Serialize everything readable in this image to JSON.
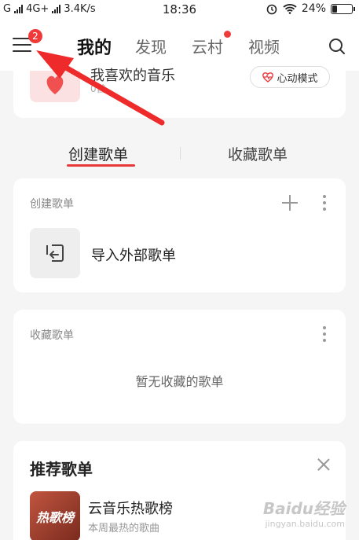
{
  "status_bar": {
    "carrier1": "G",
    "carrier2": "4G+",
    "speed": "3.4K/s",
    "time": "18:36",
    "battery": "24%",
    "battery_level": 0.24
  },
  "nav": {
    "menu_badge": "2",
    "tabs": [
      "我的",
      "发现",
      "云村",
      "视频"
    ],
    "active_tab": "我的"
  },
  "liked": {
    "title": "我喜欢的音乐",
    "count": "0首",
    "heart_mode_label": "心动模式"
  },
  "segments": {
    "created": "创建歌单",
    "collected": "收藏歌单"
  },
  "created_section": {
    "title": "创建歌单",
    "import_label": "导入外部歌单"
  },
  "collected_section": {
    "title": "收藏歌单",
    "empty_text": "暂无收藏的歌单"
  },
  "recommend": {
    "title": "推荐歌单",
    "playlist_name": "云音乐热歌榜",
    "playlist_desc": "本周最热的歌曲",
    "cover_text": "热歌榜"
  },
  "watermark": {
    "text": "Baidu经验",
    "sub": "jingyan.baidu.com"
  },
  "colors": {
    "accent": "#e8393a",
    "badge": "#f03a3a",
    "background": "#f5f5f5"
  }
}
